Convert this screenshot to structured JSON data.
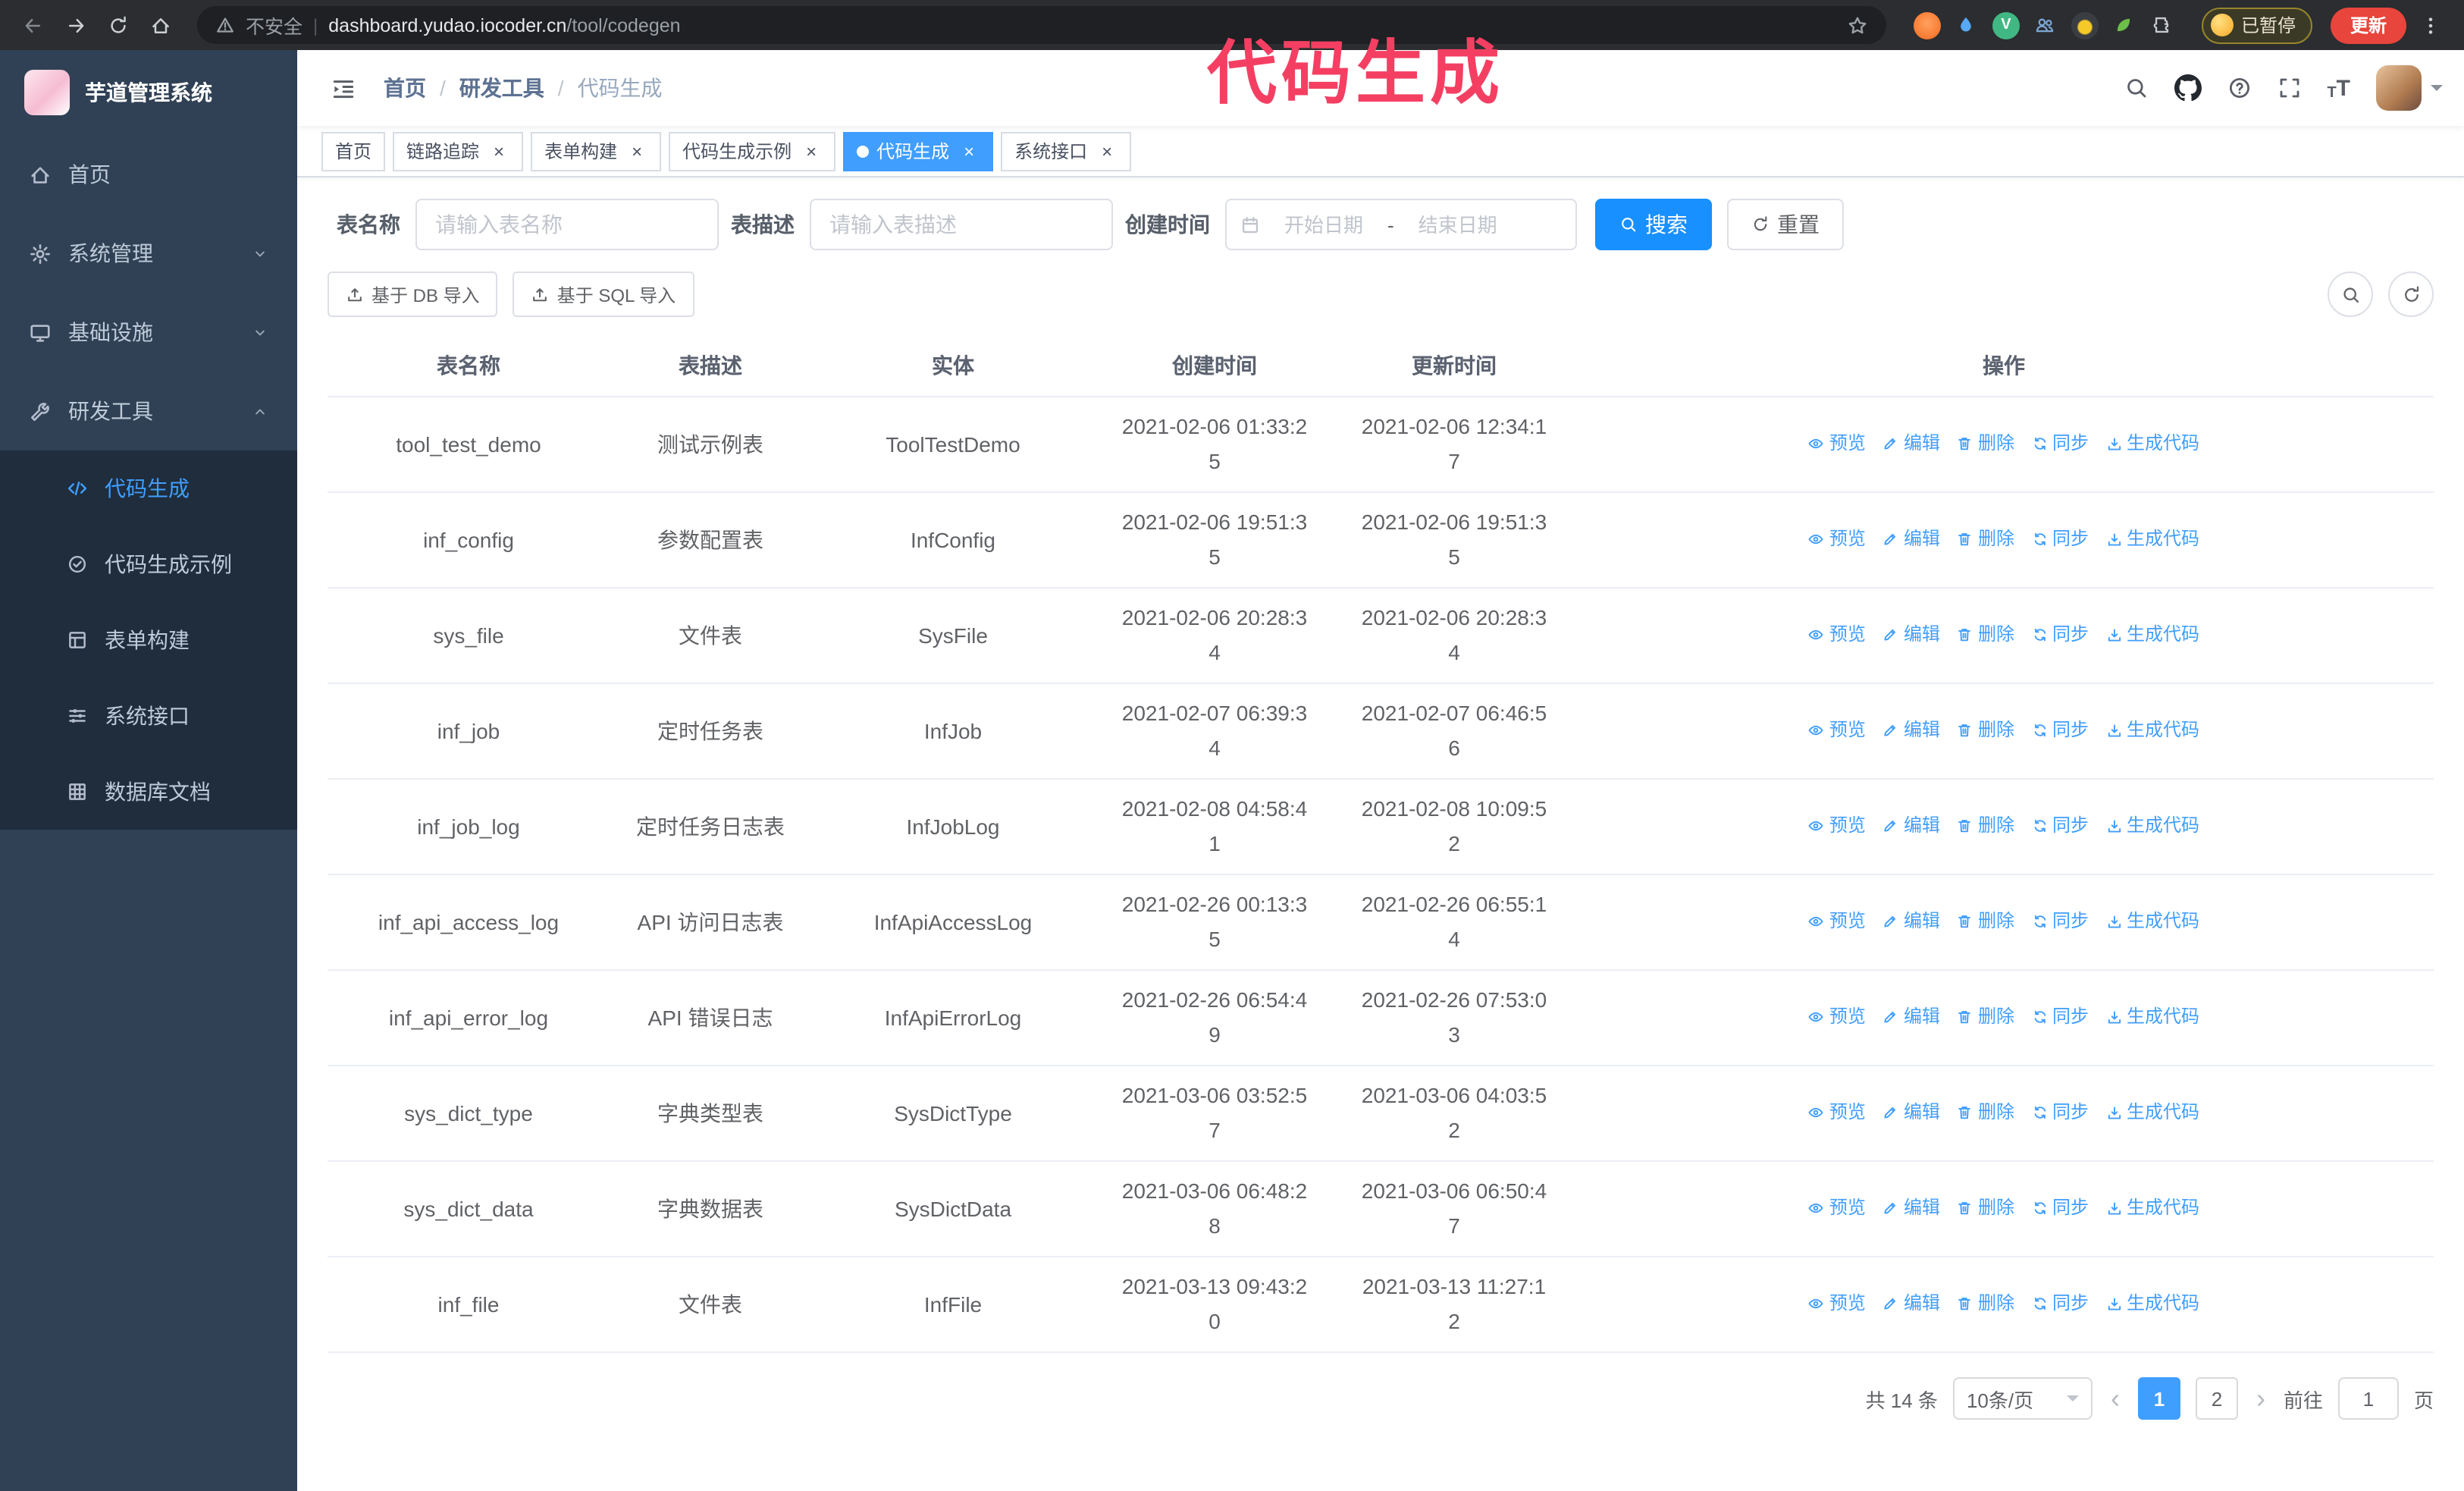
{
  "colors": {
    "accent": "#409eff",
    "primary_button": "#1890ff",
    "annotation": "#f43f63",
    "sidebar_bg": "#304156",
    "submenu_bg": "#1f2d3d",
    "active_tab": "#409eff"
  },
  "browser": {
    "security_label": "不安全",
    "url_domain": "dashboard.yudao.iocoder.cn",
    "url_path": "/tool/codegen",
    "paused_label": "已暂停",
    "update_label": "更新"
  },
  "annotation": {
    "text": "代码生成"
  },
  "sidebar": {
    "logo_title": "芋道管理系统",
    "items": [
      {
        "id": "home",
        "label": "首页",
        "icon": "home-icon"
      },
      {
        "id": "system",
        "label": "系统管理",
        "icon": "gear-icon",
        "expandable": true
      },
      {
        "id": "infra",
        "label": "基础设施",
        "icon": "monitor-icon",
        "expandable": true
      },
      {
        "id": "devtools",
        "label": "研发工具",
        "icon": "wrench-icon",
        "expandable": true,
        "expanded": true
      }
    ],
    "subitems": [
      {
        "id": "codegen",
        "label": "代码生成",
        "icon": "code-icon",
        "active": true
      },
      {
        "id": "codegen-example",
        "label": "代码生成示例",
        "icon": "badge-icon"
      },
      {
        "id": "form-builder",
        "label": "表单构建",
        "icon": "form-icon"
      },
      {
        "id": "system-api",
        "label": "系统接口",
        "icon": "sliders-icon"
      },
      {
        "id": "db-doc",
        "label": "数据库文档",
        "icon": "grid-icon"
      }
    ]
  },
  "header": {
    "breadcrumb": [
      "首页",
      "研发工具",
      "代码生成"
    ]
  },
  "tabs": [
    {
      "label": "首页",
      "closable": false
    },
    {
      "label": "链路追踪",
      "closable": true
    },
    {
      "label": "表单构建",
      "closable": true
    },
    {
      "label": "代码生成示例",
      "closable": true
    },
    {
      "label": "代码生成",
      "closable": true,
      "active": true
    },
    {
      "label": "系统接口",
      "closable": true
    }
  ],
  "filters": {
    "table_name_label": "表名称",
    "table_name_placeholder": "请输入表名称",
    "table_desc_label": "表描述",
    "table_desc_placeholder": "请输入表描述",
    "create_time_label": "创建时间",
    "date_start_placeholder": "开始日期",
    "date_separator": "-",
    "date_end_placeholder": "结束日期",
    "search_label": "搜索",
    "reset_label": "重置"
  },
  "toolbar": {
    "import_db_label": "基于 DB 导入",
    "import_sql_label": "基于 SQL 导入"
  },
  "table": {
    "columns": [
      "表名称",
      "表描述",
      "实体",
      "创建时间",
      "更新时间",
      "操作"
    ],
    "actions": [
      {
        "name": "preview-link",
        "label": "预览",
        "icon": "eye-icon"
      },
      {
        "name": "edit-link",
        "label": "编辑",
        "icon": "edit-icon"
      },
      {
        "name": "delete-link",
        "label": "删除",
        "icon": "delete-icon"
      },
      {
        "name": "sync-link",
        "label": "同步",
        "icon": "sync-icon"
      },
      {
        "name": "generate-code-link",
        "label": "生成代码",
        "icon": "download-icon"
      }
    ],
    "rows": [
      {
        "name": "tool_test_demo",
        "desc": "测试示例表",
        "entity": "ToolTestDemo",
        "created": "2021-02-06 01:33:25",
        "updated": "2021-02-06 12:34:17"
      },
      {
        "name": "inf_config",
        "desc": "参数配置表",
        "entity": "InfConfig",
        "created": "2021-02-06 19:51:35",
        "updated": "2021-02-06 19:51:35"
      },
      {
        "name": "sys_file",
        "desc": "文件表",
        "entity": "SysFile",
        "created": "2021-02-06 20:28:34",
        "updated": "2021-02-06 20:28:34"
      },
      {
        "name": "inf_job",
        "desc": "定时任务表",
        "entity": "InfJob",
        "created": "2021-02-07 06:39:34",
        "updated": "2021-02-07 06:46:56"
      },
      {
        "name": "inf_job_log",
        "desc": "定时任务日志表",
        "entity": "InfJobLog",
        "created": "2021-02-08 04:58:41",
        "updated": "2021-02-08 10:09:52"
      },
      {
        "name": "inf_api_access_log",
        "desc": "API 访问日志表",
        "entity": "InfApiAccessLog",
        "created": "2021-02-26 00:13:35",
        "updated": "2021-02-26 06:55:14"
      },
      {
        "name": "inf_api_error_log",
        "desc": "API 错误日志",
        "entity": "InfApiErrorLog",
        "created": "2021-02-26 06:54:49",
        "updated": "2021-02-26 07:53:03"
      },
      {
        "name": "sys_dict_type",
        "desc": "字典类型表",
        "entity": "SysDictType",
        "created": "2021-03-06 03:52:57",
        "updated": "2021-03-06 04:03:52"
      },
      {
        "name": "sys_dict_data",
        "desc": "字典数据表",
        "entity": "SysDictData",
        "created": "2021-03-06 06:48:28",
        "updated": "2021-03-06 06:50:47"
      },
      {
        "name": "inf_file",
        "desc": "文件表",
        "entity": "InfFile",
        "created": "2021-03-13 09:43:20",
        "updated": "2021-03-13 11:27:12"
      }
    ]
  },
  "pagination": {
    "total_label": "共 14 条",
    "page_size_label": "10条/页",
    "pages": [
      "1",
      "2"
    ],
    "active_page": "1",
    "goto_label": "前往",
    "goto_value": "1",
    "goto_suffix": "页"
  }
}
